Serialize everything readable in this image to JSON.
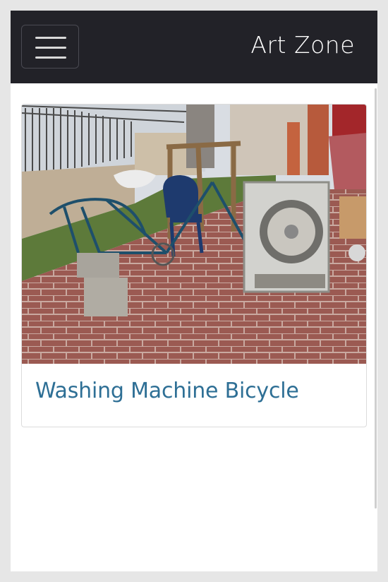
{
  "header": {
    "brand": "Art Zone",
    "menu_icon": "hamburger-menu-icon",
    "background": "#222228"
  },
  "card": {
    "title": "Washing Machine Bicycle",
    "title_color": "#2e6f95",
    "image_alt": "Washing Machine Bicycle"
  }
}
